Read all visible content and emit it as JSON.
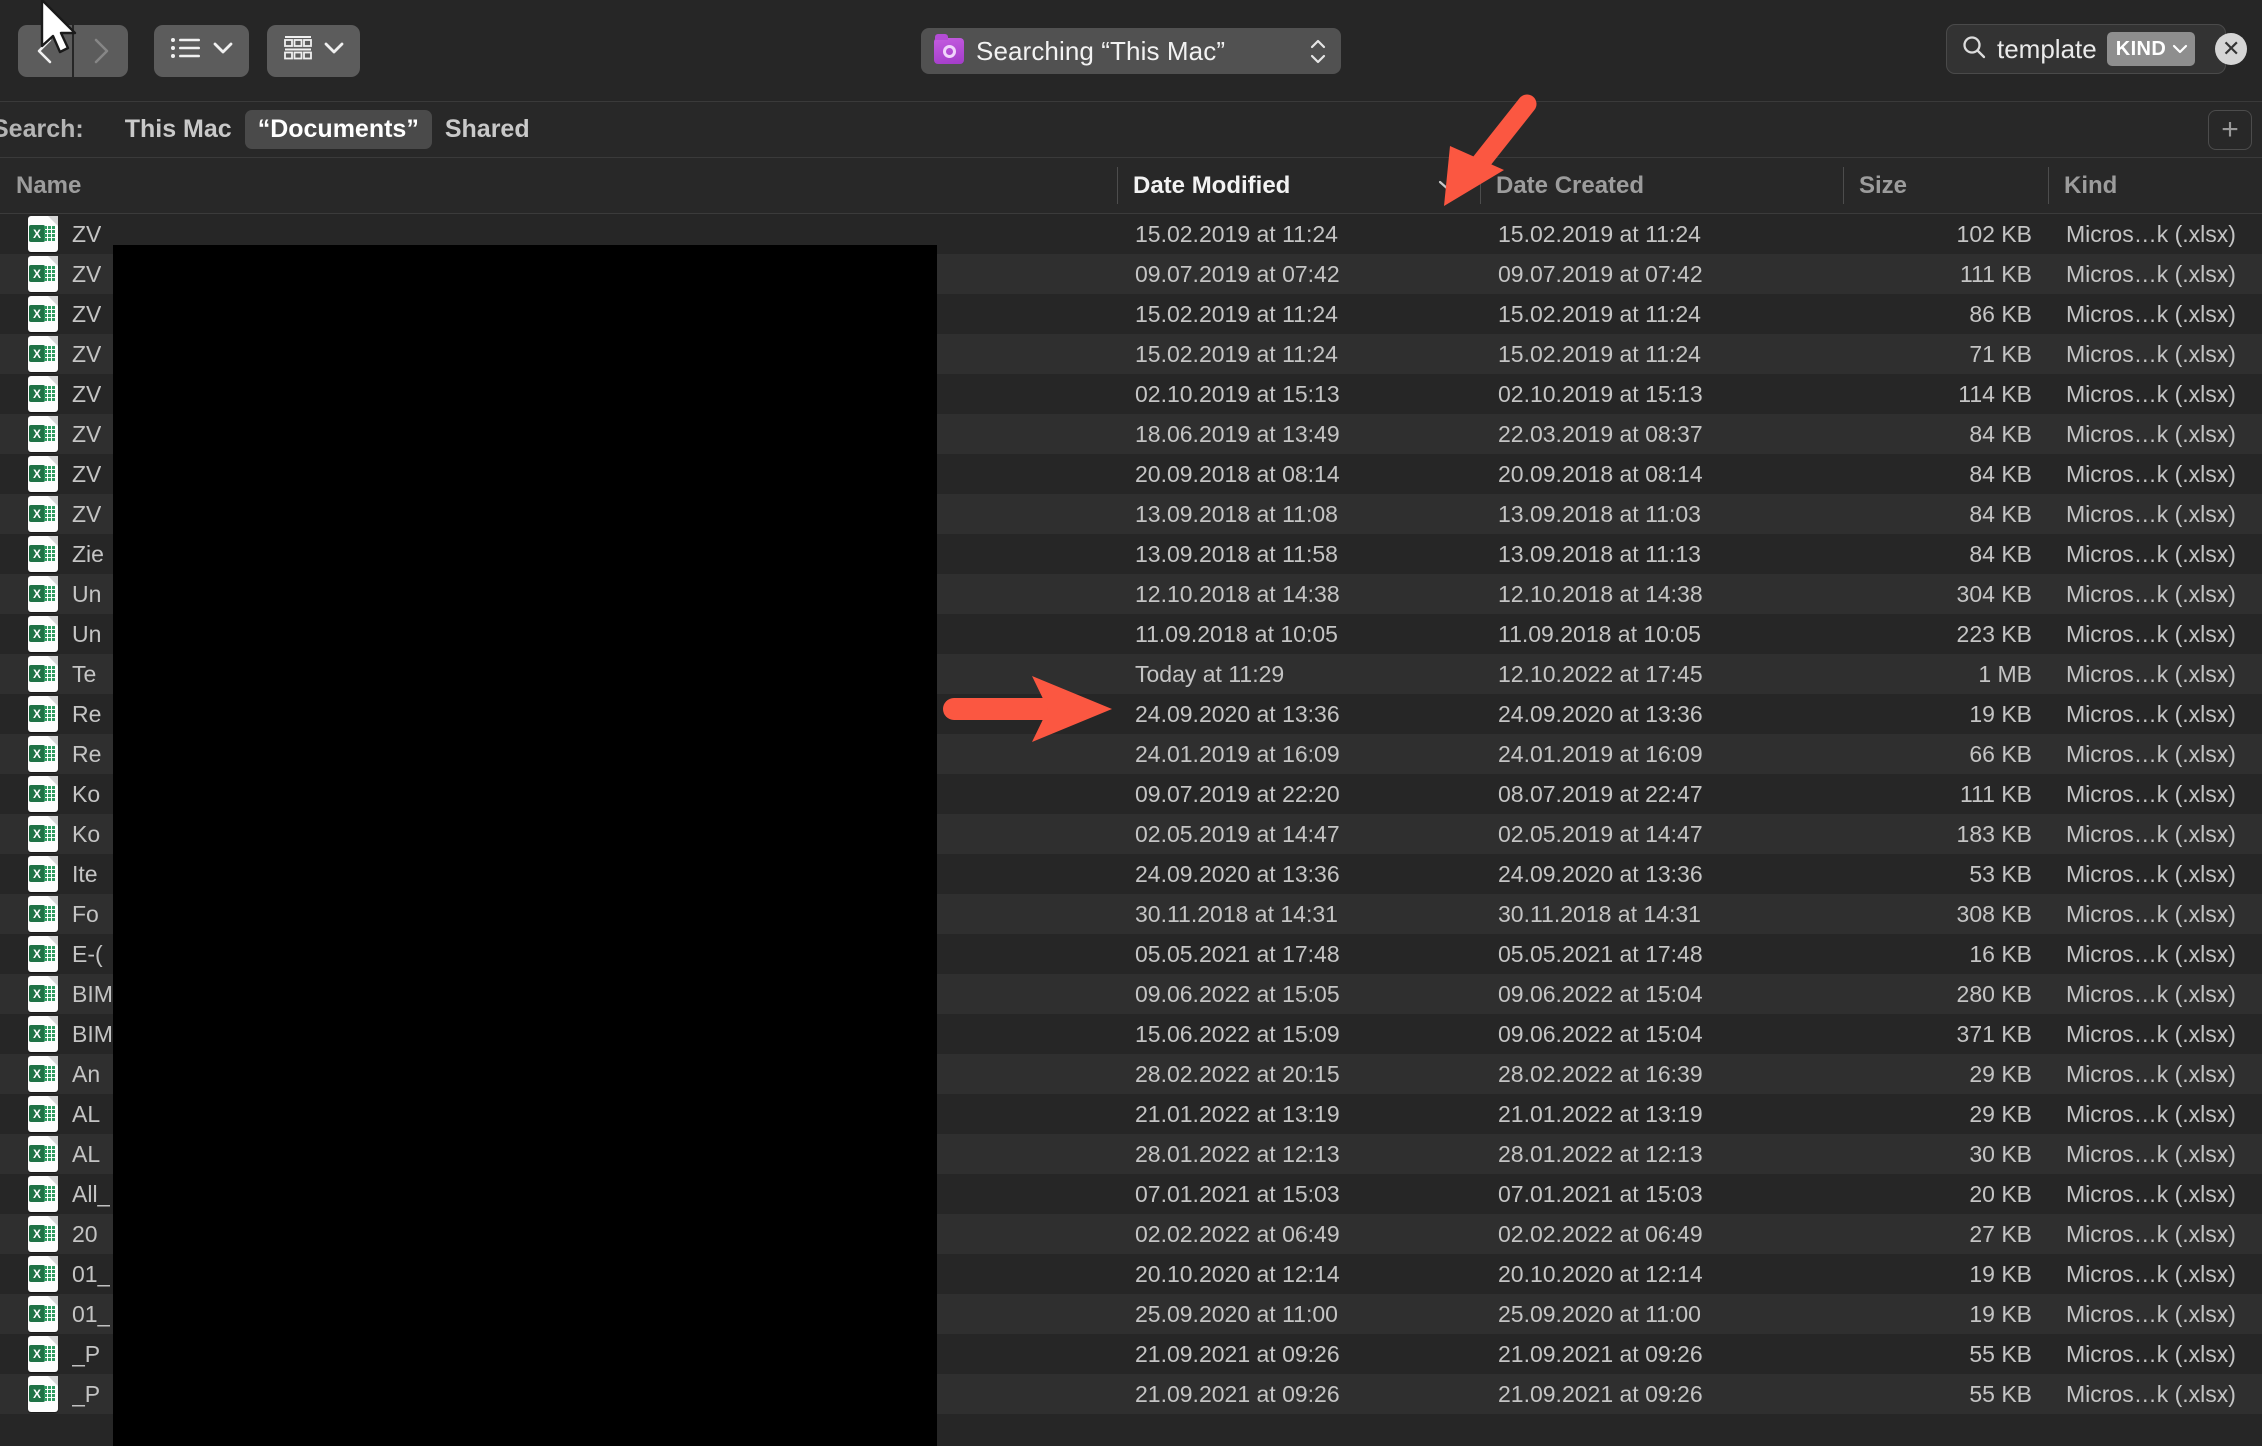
{
  "toolbar": {
    "back_label": "Back",
    "forward_label": "Forward",
    "list_view_label": "List View",
    "group_view_label": "Group By",
    "title": "Searching “This Mac”",
    "folder_icon": "smart-folder-icon"
  },
  "search": {
    "icon": "search-icon",
    "query": "template",
    "token_label": "KIND",
    "clear_label": "✕"
  },
  "scope": {
    "label": "Search:",
    "items": [
      {
        "label": "This Mac",
        "active": false
      },
      {
        "label": "“Documents”",
        "active": true
      },
      {
        "label": "Shared",
        "active": false
      }
    ],
    "add_label": "+"
  },
  "columns": [
    {
      "key": "name",
      "label": "Name",
      "sorted": false
    },
    {
      "key": "date_modified",
      "label": "Date Modified",
      "sorted": true,
      "sort_caret": "⌄"
    },
    {
      "key": "date_created",
      "label": "Date Created",
      "sorted": false
    },
    {
      "key": "size",
      "label": "Size",
      "sorted": false
    },
    {
      "key": "kind",
      "label": "Kind",
      "sorted": false
    }
  ],
  "rows": [
    {
      "name": "ZV",
      "date_modified": "15.02.2019 at 11:24",
      "date_created": "15.02.2019 at 11:24",
      "size": "102 KB",
      "kind": "Micros…k (.xlsx)"
    },
    {
      "name": "ZV",
      "date_modified": "09.07.2019 at 07:42",
      "date_created": "09.07.2019 at 07:42",
      "size": "111 KB",
      "kind": "Micros…k (.xlsx)"
    },
    {
      "name": "ZV",
      "date_modified": "15.02.2019 at 11:24",
      "date_created": "15.02.2019 at 11:24",
      "size": "86 KB",
      "kind": "Micros…k (.xlsx)"
    },
    {
      "name": "ZV",
      "date_modified": "15.02.2019 at 11:24",
      "date_created": "15.02.2019 at 11:24",
      "size": "71 KB",
      "kind": "Micros…k (.xlsx)"
    },
    {
      "name": "ZV",
      "date_modified": "02.10.2019 at 15:13",
      "date_created": "02.10.2019 at 15:13",
      "size": "114 KB",
      "kind": "Micros…k (.xlsx)"
    },
    {
      "name": "ZV",
      "date_modified": "18.06.2019 at 13:49",
      "date_created": "22.03.2019 at 08:37",
      "size": "84 KB",
      "kind": "Micros…k (.xlsx)"
    },
    {
      "name": "ZV",
      "date_modified": "20.09.2018 at 08:14",
      "date_created": "20.09.2018 at 08:14",
      "size": "84 KB",
      "kind": "Micros…k (.xlsx)"
    },
    {
      "name": "ZV",
      "date_modified": "13.09.2018 at 11:08",
      "date_created": "13.09.2018 at 11:03",
      "size": "84 KB",
      "kind": "Micros…k (.xlsx)"
    },
    {
      "name": "Zie",
      "date_modified": "13.09.2018 at 11:58",
      "date_created": "13.09.2018 at 11:13",
      "size": "84 KB",
      "kind": "Micros…k (.xlsx)"
    },
    {
      "name": "Un",
      "date_modified": "12.10.2018 at 14:38",
      "date_created": "12.10.2018 at 14:38",
      "size": "304 KB",
      "kind": "Micros…k (.xlsx)"
    },
    {
      "name": "Un",
      "date_modified": "11.09.2018 at 10:05",
      "date_created": "11.09.2018 at 10:05",
      "size": "223 KB",
      "kind": "Micros…k (.xlsx)"
    },
    {
      "name": "Te",
      "date_modified": "Today at 11:29",
      "date_created": "12.10.2022 at 17:45",
      "size": "1 MB",
      "kind": "Micros…k (.xlsx)"
    },
    {
      "name": "Re",
      "date_modified": "24.09.2020 at 13:36",
      "date_created": "24.09.2020 at 13:36",
      "size": "19 KB",
      "kind": "Micros…k (.xlsx)"
    },
    {
      "name": "Re",
      "date_modified": "24.01.2019 at 16:09",
      "date_created": "24.01.2019 at 16:09",
      "size": "66 KB",
      "kind": "Micros…k (.xlsx)"
    },
    {
      "name": "Ko",
      "date_modified": "09.07.2019 at 22:20",
      "date_created": "08.07.2019 at 22:47",
      "size": "111 KB",
      "kind": "Micros…k (.xlsx)"
    },
    {
      "name": "Ko",
      "date_modified": "02.05.2019 at 14:47",
      "date_created": "02.05.2019 at 14:47",
      "size": "183 KB",
      "kind": "Micros…k (.xlsx)"
    },
    {
      "name": "Ite",
      "date_modified": "24.09.2020 at 13:36",
      "date_created": "24.09.2020 at 13:36",
      "size": "53 KB",
      "kind": "Micros…k (.xlsx)"
    },
    {
      "name": "Fo",
      "date_modified": "30.11.2018 at 14:31",
      "date_created": "30.11.2018 at 14:31",
      "size": "308 KB",
      "kind": "Micros…k (.xlsx)"
    },
    {
      "name": "E-(",
      "date_modified": "05.05.2021 at 17:48",
      "date_created": "05.05.2021 at 17:48",
      "size": "16 KB",
      "kind": "Micros…k (.xlsx)"
    },
    {
      "name": "BIM",
      "date_modified": "09.06.2022 at 15:05",
      "date_created": "09.06.2022 at 15:04",
      "size": "280 KB",
      "kind": "Micros…k (.xlsx)"
    },
    {
      "name": "BIM",
      "date_modified": "15.06.2022 at 15:09",
      "date_created": "09.06.2022 at 15:04",
      "size": "371 KB",
      "kind": "Micros…k (.xlsx)"
    },
    {
      "name": "An",
      "date_modified": "28.02.2022 at 20:15",
      "date_created": "28.02.2022 at 16:39",
      "size": "29 KB",
      "kind": "Micros…k (.xlsx)"
    },
    {
      "name": "AL",
      "date_modified": "21.01.2022 at 13:19",
      "date_created": "21.01.2022 at 13:19",
      "size": "29 KB",
      "kind": "Micros…k (.xlsx)"
    },
    {
      "name": "AL",
      "date_modified": "28.01.2022 at 12:13",
      "date_created": "28.01.2022 at 12:13",
      "size": "30 KB",
      "kind": "Micros…k (.xlsx)"
    },
    {
      "name": "All_",
      "date_modified": "07.01.2021 at 15:03",
      "date_created": "07.01.2021 at 15:03",
      "size": "20 KB",
      "kind": "Micros…k (.xlsx)"
    },
    {
      "name": "20",
      "date_modified": "02.02.2022 at 06:49",
      "date_created": "02.02.2022 at 06:49",
      "size": "27 KB",
      "kind": "Micros…k (.xlsx)"
    },
    {
      "name": "01_",
      "date_modified": "20.10.2020 at 12:14",
      "date_created": "20.10.2020 at 12:14",
      "size": "19 KB",
      "kind": "Micros…k (.xlsx)"
    },
    {
      "name": "01_",
      "date_modified": "25.09.2020 at 11:00",
      "date_created": "25.09.2020 at 11:00",
      "size": "19 KB",
      "kind": "Micros…k (.xlsx)"
    },
    {
      "name": "_P",
      "date_modified": "21.09.2021 at 09:26",
      "date_created": "21.09.2021 at 09:26",
      "size": "55 KB",
      "kind": "Micros…k (.xlsx)"
    },
    {
      "name": "_P",
      "date_modified": "21.09.2021 at 09:26",
      "date_created": "21.09.2021 at 09:26",
      "size": "55 KB",
      "kind": "Micros…k (.xlsx)"
    }
  ],
  "annotations": {
    "color": "#fb5741",
    "redaction_color": "#000000",
    "arrow_sort_target": "date-modified-sort-caret",
    "arrow_row_target": "Today at 11:29"
  }
}
